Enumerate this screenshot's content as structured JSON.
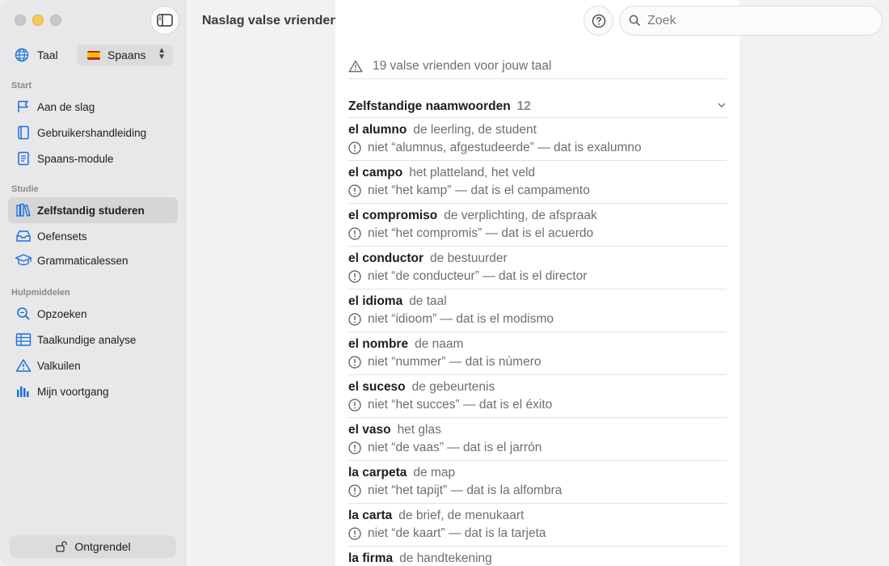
{
  "sidebar": {
    "language_label": "Taal",
    "language_value": "Spaans",
    "sections": [
      {
        "label": "Start",
        "items": [
          {
            "label": "Aan de slag",
            "icon": "flag-icon"
          },
          {
            "label": "Gebruikershandleiding",
            "icon": "book-icon"
          },
          {
            "label": "Spaans-module",
            "icon": "document-icon"
          }
        ]
      },
      {
        "label": "Studie",
        "items": [
          {
            "label": "Zelfstandig studeren",
            "icon": "books-icon",
            "active": true
          },
          {
            "label": "Oefensets",
            "icon": "tray-icon"
          },
          {
            "label": "Grammaticalessen",
            "icon": "graduation-cap-icon"
          }
        ]
      },
      {
        "label": "Hulpmiddelen",
        "items": [
          {
            "label": "Opzoeken",
            "icon": "magnifier-icon"
          },
          {
            "label": "Taalkundige analyse",
            "icon": "table-icon"
          },
          {
            "label": "Valkuilen",
            "icon": "warning-icon"
          },
          {
            "label": "Mijn voortgang",
            "icon": "bar-chart-icon"
          }
        ]
      }
    ],
    "unlock_label": "Ontgrendel"
  },
  "toolbar": {
    "title": "Naslag valse vrienden",
    "search_placeholder": "Zoek"
  },
  "content": {
    "count_text": "19 valse vrienden voor jouw taal",
    "group": {
      "title": "Zelfstandige naamwoorden",
      "count": "12",
      "entries": [
        {
          "word": "el alumno",
          "meaning": "de leerling, de student",
          "note": "niet “alumnus, afgestudeerde” — dat is exalumno"
        },
        {
          "word": "el campo",
          "meaning": "het platteland, het veld",
          "note": "niet “het kamp” — dat is el campamento"
        },
        {
          "word": "el compromiso",
          "meaning": "de verplichting, de afspraak",
          "note": "niet “het compromis” — dat is el acuerdo"
        },
        {
          "word": "el conductor",
          "meaning": "de bestuurder",
          "note": "niet “de conducteur” — dat is el director"
        },
        {
          "word": "el idioma",
          "meaning": "de taal",
          "note": "niet “idioom” — dat is el modismo"
        },
        {
          "word": "el nombre",
          "meaning": "de naam",
          "note": "niet “nummer” — dat is número"
        },
        {
          "word": "el suceso",
          "meaning": "de gebeurtenis",
          "note": "niet “het succes” — dat is el éxito"
        },
        {
          "word": "el vaso",
          "meaning": "het glas",
          "note": "niet “de vaas” — dat is el jarrón"
        },
        {
          "word": "la carpeta",
          "meaning": "de map",
          "note": "niet “het tapijt” — dat is la alfombra"
        },
        {
          "word": "la carta",
          "meaning": "de brief, de menukaart",
          "note": "niet “de kaart” — dat is la tarjeta"
        },
        {
          "word": "la firma",
          "meaning": "de handtekening",
          "note": ""
        }
      ]
    }
  },
  "colors": {
    "accent": "#1a6fdc",
    "sidebar_bg": "#e8e8ea",
    "content_bg": "#ffffff",
    "secondary_text": "#6e6e73"
  }
}
